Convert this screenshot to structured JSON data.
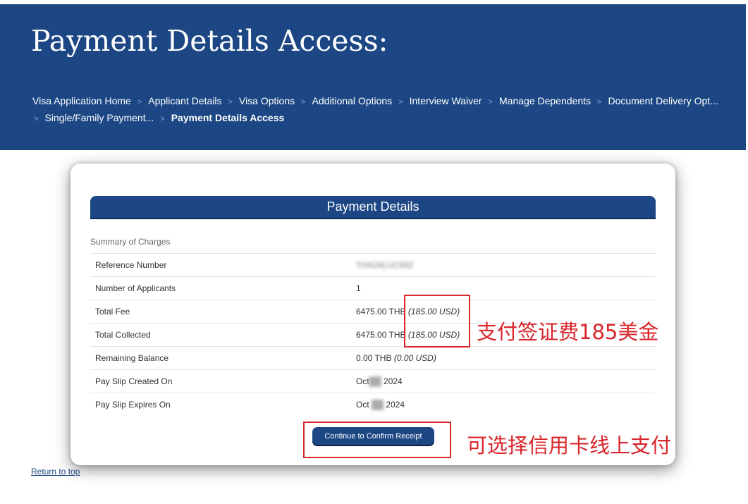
{
  "header": {
    "title": "Payment Details Access:",
    "breadcrumbs": [
      "Visa Application Home",
      "Applicant Details",
      "Visa Options",
      "Additional Options",
      "Interview Waiver",
      "Manage Dependents",
      "Document Delivery Opt...",
      "Single/Family Payment...",
      "Payment Details Access"
    ],
    "separator": ">"
  },
  "panel": {
    "title": "Payment Details",
    "summary_label": "Summary of Charges",
    "rows": [
      {
        "label": "Reference Number",
        "value": "THA24LUC932",
        "blurred": true
      },
      {
        "label": "Number of Applicants",
        "value": "1"
      },
      {
        "label": "Total Fee",
        "value": "6475.00 THB",
        "usd": "(185.00 USD)"
      },
      {
        "label": "Total Collected",
        "value": "6475.00 THB",
        "usd": "(185.00 USD)"
      },
      {
        "label": "Remaining Balance",
        "value": "0.00 THB",
        "usd": "(0.00 USD)"
      },
      {
        "label": "Pay Slip Created On",
        "value_pre": "Oct",
        "value_post": "2024"
      },
      {
        "label": "Pay Slip Expires On",
        "value_pre": "Oct",
        "value_post": "2024"
      }
    ],
    "confirm_button": "Continue to Confirm Receipt"
  },
  "annotations": {
    "fee_note": "支付签证费185美金",
    "pay_note": "可选择信用卡线上支付",
    "color": "#d9262b"
  },
  "footer": {
    "return_link": "Return to top"
  },
  "colors": {
    "header_bg": "#1c4784",
    "panel_bg": "#1c4784"
  }
}
